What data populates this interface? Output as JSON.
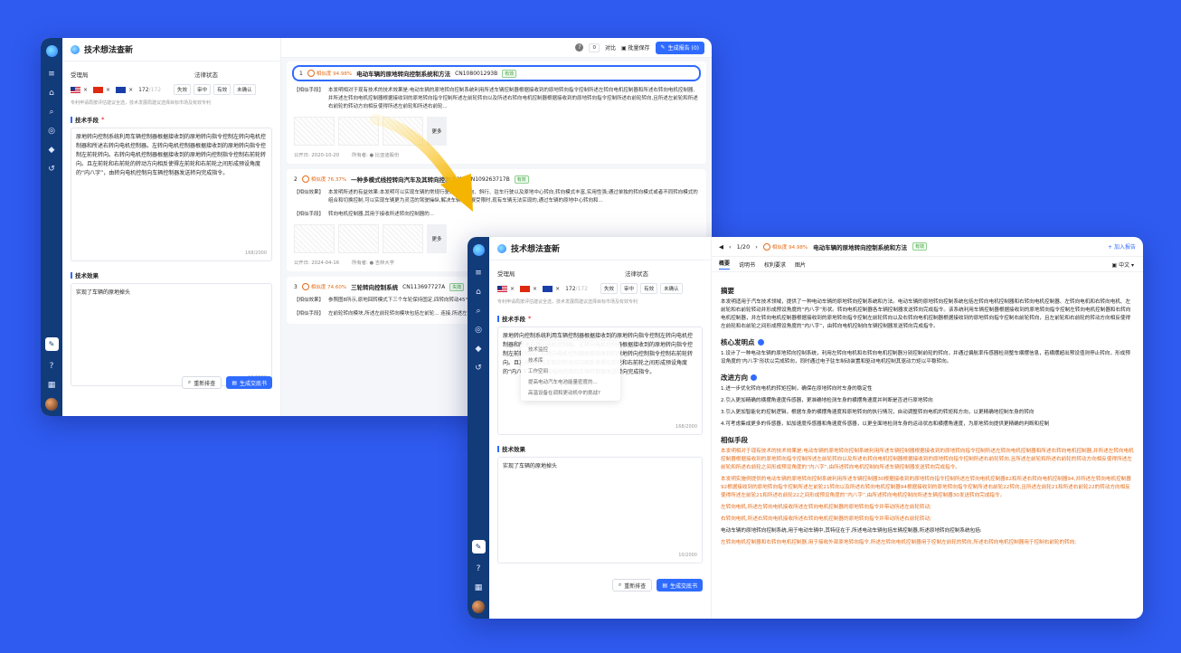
{
  "app": {
    "title": "技术想法查新"
  },
  "left": {
    "office_label": "受理局",
    "status_label": "法律状态",
    "count": "172",
    "count_total": "/172",
    "statuses": [
      "失效",
      "审中",
      "有效",
      "未确认"
    ],
    "hint": "专利申请局按评估建议全选，技术发展局建议选择目标市场及有效专利",
    "tech_label": "技术手段",
    "required": "*",
    "tech_text": "原地转向控制系统利用车辆控制器根据接收到的原地转向指令控制左转向电机控制器和所述右转向电机控制器。左转向电机控制器根据接收到的原地转向指令控制左前轮转向。右转向电机控制器根据接收到的原地转向控制指令控制右前轮转向。且左前轮和右前轮的转动方向相反使得左前轮和右前轮之间形成预设角度的“内八字”，由转向电机控制向车辆控制器发送转向完成指令。",
    "tech_counter": "168/2000",
    "effect_label": "技术效果",
    "effect_text": "实现了车辆的原地掉头",
    "effect_counter": "10/2000",
    "btn_reset": "重新排查",
    "btn_report": "生成交底书"
  },
  "dropdown": [
    "技术监控",
    "技术库",
    "工作空间",
    "提高电动汽车电池能量密度的...",
    "高温设备在调和更动机中的挑战?"
  ],
  "toolbar": {
    "compare": "对比",
    "compare_count": "0",
    "batch_save": "批量保存",
    "generate": "生成报告 (0)"
  },
  "results": [
    {
      "idx": "1",
      "sim": "相似度 94.98%",
      "title": "电动车辆的原地转向控制系统和方法",
      "pn": "CN108001293B",
      "tag": "有效",
      "key": "【相似手段】",
      "text": "本发明相对于现有技术的技术效果是:电动车辆的原地转向控制系统利用所述车辆控制器根据接收到的原地转向指令控制所述左转向电机控制器和所述右转向电机控制器,并所述左转向电机控制器根据接收到的原地转向指令控制所述左前轮转向以及所述右转向电机控制器根据接收到的原地转向指令控制所述右前轮转向,且所述左前轮和所述右前轮的转动方向相反使得所述左前轮和所述右前轮...",
      "more": "更多",
      "date": "公开日:  2020-10-20",
      "owner": "所有者:  ● 比亚迪股份"
    },
    {
      "idx": "2",
      "sim": "相似度 76.37%",
      "title": "一种多模式线控转向汽车及其转向控制方法",
      "pn": "CN109263717B",
      "tag": "有效",
      "key": "【相似效果】",
      "text": "本发明所述的有益效果:本发明可以实现车辆的常规行驶、四轮转向、斜行、驻车行驶以及原地中心转向,转向模式丰富,实用性强;通过单独的转向模式或者不同转向模式的组合和切换控制,可以实现车辆更为灵活的驾驶操纵,解决车辆在发展受限时,现有车辆无法实现的,通过车辆的原地中心转向和...",
      "key2": "【相似手段】",
      "text2": "转向电机控制器,其用于接收所述转向控制器的...",
      "more": "更多",
      "date": "公开日:  2024-04-16",
      "owner": "所有者:  ● 吉林大学"
    },
    {
      "idx": "3",
      "sim": "相似度 74.60%",
      "title": "三轮转向控制系统",
      "pn": "CN113697727A",
      "tag": "失效",
      "key": "【相似效果】",
      "text": "参照图8所示,原地回转模式下三个车轮保持固定,四转向转动45°和右前...",
      "key2": "【相似手段】",
      "text2": "左前轮转向模块,所述左前轮转向模块包括左前轮... 连接,所述左前轮转向电机驱动左前轮转动;"
    }
  ],
  "detail": {
    "pager": "1/20",
    "sim": "相似度 94.98%",
    "title": "电动车辆的原地转向控制系统和方法",
    "tag": "有效",
    "add": "+ 加入报告",
    "tabs": [
      "概要",
      "说明书",
      "权利要求",
      "图片"
    ],
    "lang": "中文",
    "abstract_h": "摘要",
    "abstract": "本发明适用于汽车技术领域，提供了一种电动车辆的原地转向控制系统和方法。电动车辆的原地转向控制系统包括左转向电机控制器和右转向电机控制器、左转向电机和右转向电机、左前轮和右前轮转动并形成预设角度的“内八字”形状。转向电机控制器各车辆控制器发送转向完成指令。该系统利用车辆控制器根据接收到的原地转向指令控制左转向电机控制器和右转向电机控制器，并左转向电机控制器根据接收到的原地转向指令控制左前轮转向以及右转向电机控制器根据接收到的原地转向指令控制右前轮转向，且左前轮和右前轮的转动方向相反使得左前轮和右前轮之间形成预设角度的“内八字”，由转向电机控制向车辆控制器发送转向完成指令。",
    "core_h": "核心发明点",
    "core": "1.设计了一种电动车辆的原地转向控制系统，利用左转向电机和右转向电机控制器分别控制前轮的转向，并通过偏航率传感器检测整车横摆信息，若横摆超出预设值则停止转向，形成预设角度的‘内八字’形状以完成转向，同时通过电子驻车制动装置和驱动电机控制其驱动力矩以平稳转向。",
    "improve_h": "改进方向",
    "improve": [
      "1.进一步优化转向电机的转矩控制，确保在原地转向时车身的稳定性",
      "2.引入更加精确的横摆角速度传感器，更准确地检测车身的横摆角速度并判断是否进行原地转向",
      "3.引入更加智能化的控制逻辑，根据车身的横摆角速度和原地转向的执行情况，自动调整转向电机的转矩和方向，以更精确地控制车身的转向",
      "4.可考虑集成更多的传感器，如加速度传感器和角速度传感器，以更全面地检测车身的运动状态和横摆角速度，为原地转向提供更精确的判断和控制"
    ],
    "means_h": "相似手段",
    "means": [
      "本发明相对于现有技术的技术效果是:电动车辆的原地转向控制系统利用所述车辆控制器根据接收到的原地转向指令控制所述左转向电机控制器和所述右转向电机控制器,并所述左转向电机控制器根据接收到的原地转向指令控制所述左前轮转向以及所述右转向电机控制器根据接收到的原地转向指令控制所述右前轮转向,且所述左前轮和所述右前轮的转动方向相反使得所述左前轮和所述右前轮之间形成预设角度的“内八字”,由所述转向电机控制向所述车辆控制器发送转向完成指令。",
      "本发明实施例提供的电动车辆的原地转向控制系统利用所述车辆控制器30根据接收到的原地转向指令控制所述左转向电机控制器82和所述右转向电机控制器94,并所述左转向电机控制器92根据接收到的原地转向指令控制所述左前轮21转向以及所述右转向电机控制器94根据接收到的原地转向指令控制所述右前轮22转向,且所述左前轮21和所述右前轮22的转动方向相反使得所述左前轮21和所述右前轮22之间形成预设角度的“内八字”,由所述转向电机控制向所述车辆控制器30发送转向完成指令。",
      "左转向电机,所述左转向电机接收所述左转向电机控制器的原地转向指令并带动所述左前轮转动;",
      "右转向电机,所述右转向电机接收所述右转向电机控制器的原地转向指令并带动所述右前轮转动;",
      "电动车辆的原地转向控制系统,用于电动车辆中,其特征在于,所述电动车辆包括车辆控制器,所述原地转向控制系统包括:",
      "左转向电机控制器和右转向电机控制器,用于接收外部原地转向指令,所述左转向电机控制器用于控制左前轮的转向,所述右转向电机控制器用于控制右前轮的转向;"
    ]
  }
}
